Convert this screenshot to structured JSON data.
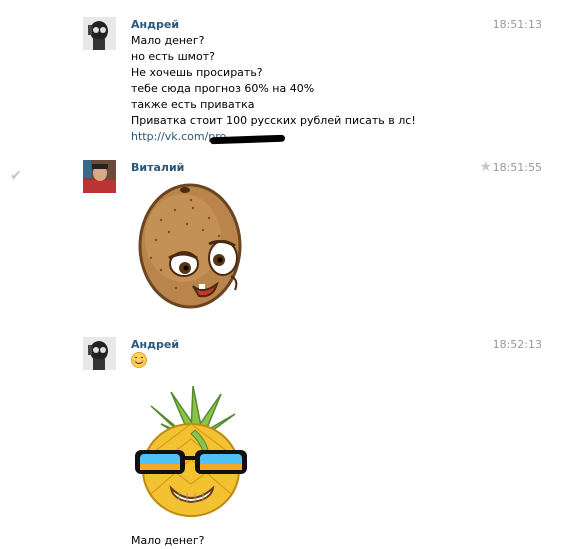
{
  "messages": [
    {
      "author": "Андрей",
      "time": "18:51:13",
      "avatar_icon": "user-avatar-skull-mask",
      "lines": [
        "Мало денег?",
        "но есть шмот?",
        "Не хочешь просирать?",
        "тебе сюда прогноз 60% на 40%",
        "также есть приватка",
        "Приватка стоит 100 русских рублей писать в лс!"
      ],
      "link": "http://vk.com/pro"
    },
    {
      "author": "Виталий",
      "time": "18:51:55",
      "avatar_icon": "user-avatar-photo",
      "sticker": "kiwi-sticker"
    },
    {
      "author": "Андрей",
      "time": "18:52:13",
      "avatar_icon": "user-avatar-skull-mask",
      "emoji": "smile-emoji",
      "sticker": "pineapple-sticker",
      "lines": [
        "Мало денег?"
      ]
    }
  ],
  "icons": {
    "read_check": "checkmark-icon",
    "favorite": "star-icon"
  },
  "colors": {
    "author": "#2b587a",
    "time": "#999999",
    "link": "#2b587a"
  }
}
